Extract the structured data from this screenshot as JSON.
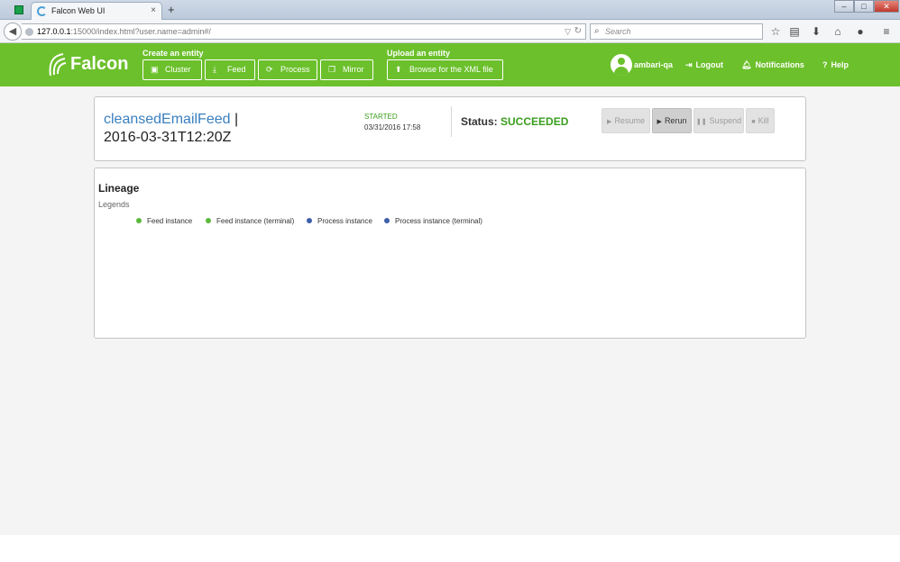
{
  "browser": {
    "tab_title": "Falcon Web UI",
    "tab_close": "×",
    "new_tab": "+",
    "url_host": "127.0.0.1",
    "url_rest": ":15000/index.html?user.name=admin#/",
    "search_placeholder": "Search",
    "window_controls": [
      "–",
      "□",
      "✕"
    ]
  },
  "header": {
    "logo": "Falcon",
    "create_label": "Create an entity",
    "create_buttons": [
      {
        "label": "Cluster",
        "icon": "cluster-icon"
      },
      {
        "label": "Feed",
        "icon": "feed-icon"
      },
      {
        "label": "Process",
        "icon": "process-icon"
      },
      {
        "label": "Mirror",
        "icon": "mirror-icon"
      }
    ],
    "upload_label": "Upload an entity",
    "upload_button": "Browse for the XML file",
    "user": "ambari-qa",
    "logout": "Logout",
    "notifications": "Notifications",
    "help": "Help"
  },
  "instance": {
    "entity_name": "cleansedEmailFeed",
    "separator": "|",
    "instance_time": "2016-03-31T12:20Z",
    "started_label": "STARTED",
    "started_date": "03/31/2016 17:58",
    "status_label": "Status:",
    "status_value": "SUCCEEDED",
    "actions": [
      {
        "label": "Resume",
        "icon": "play-icon",
        "enabled": false
      },
      {
        "label": "Rerun",
        "icon": "play-icon",
        "enabled": true
      },
      {
        "label": "Suspend",
        "icon": "pause-icon",
        "enabled": false
      },
      {
        "label": "Kill",
        "icon": "stop-icon",
        "enabled": false
      }
    ]
  },
  "lineage": {
    "title": "Lineage",
    "legends_label": "Legends",
    "legend": [
      {
        "label": "Feed instance",
        "color": "#5cb83a"
      },
      {
        "label": "Feed instance (terminal)",
        "color": "#5cb83a"
      },
      {
        "label": "Process instance",
        "color": "#3d5fa8"
      },
      {
        "label": "Process instance (terminal)",
        "color": "#3d5fa8"
      }
    ]
  },
  "colors": {
    "header_green": "#6cc02c",
    "status_green": "#3a9e1e",
    "link_blue": "#3a7fc0"
  }
}
